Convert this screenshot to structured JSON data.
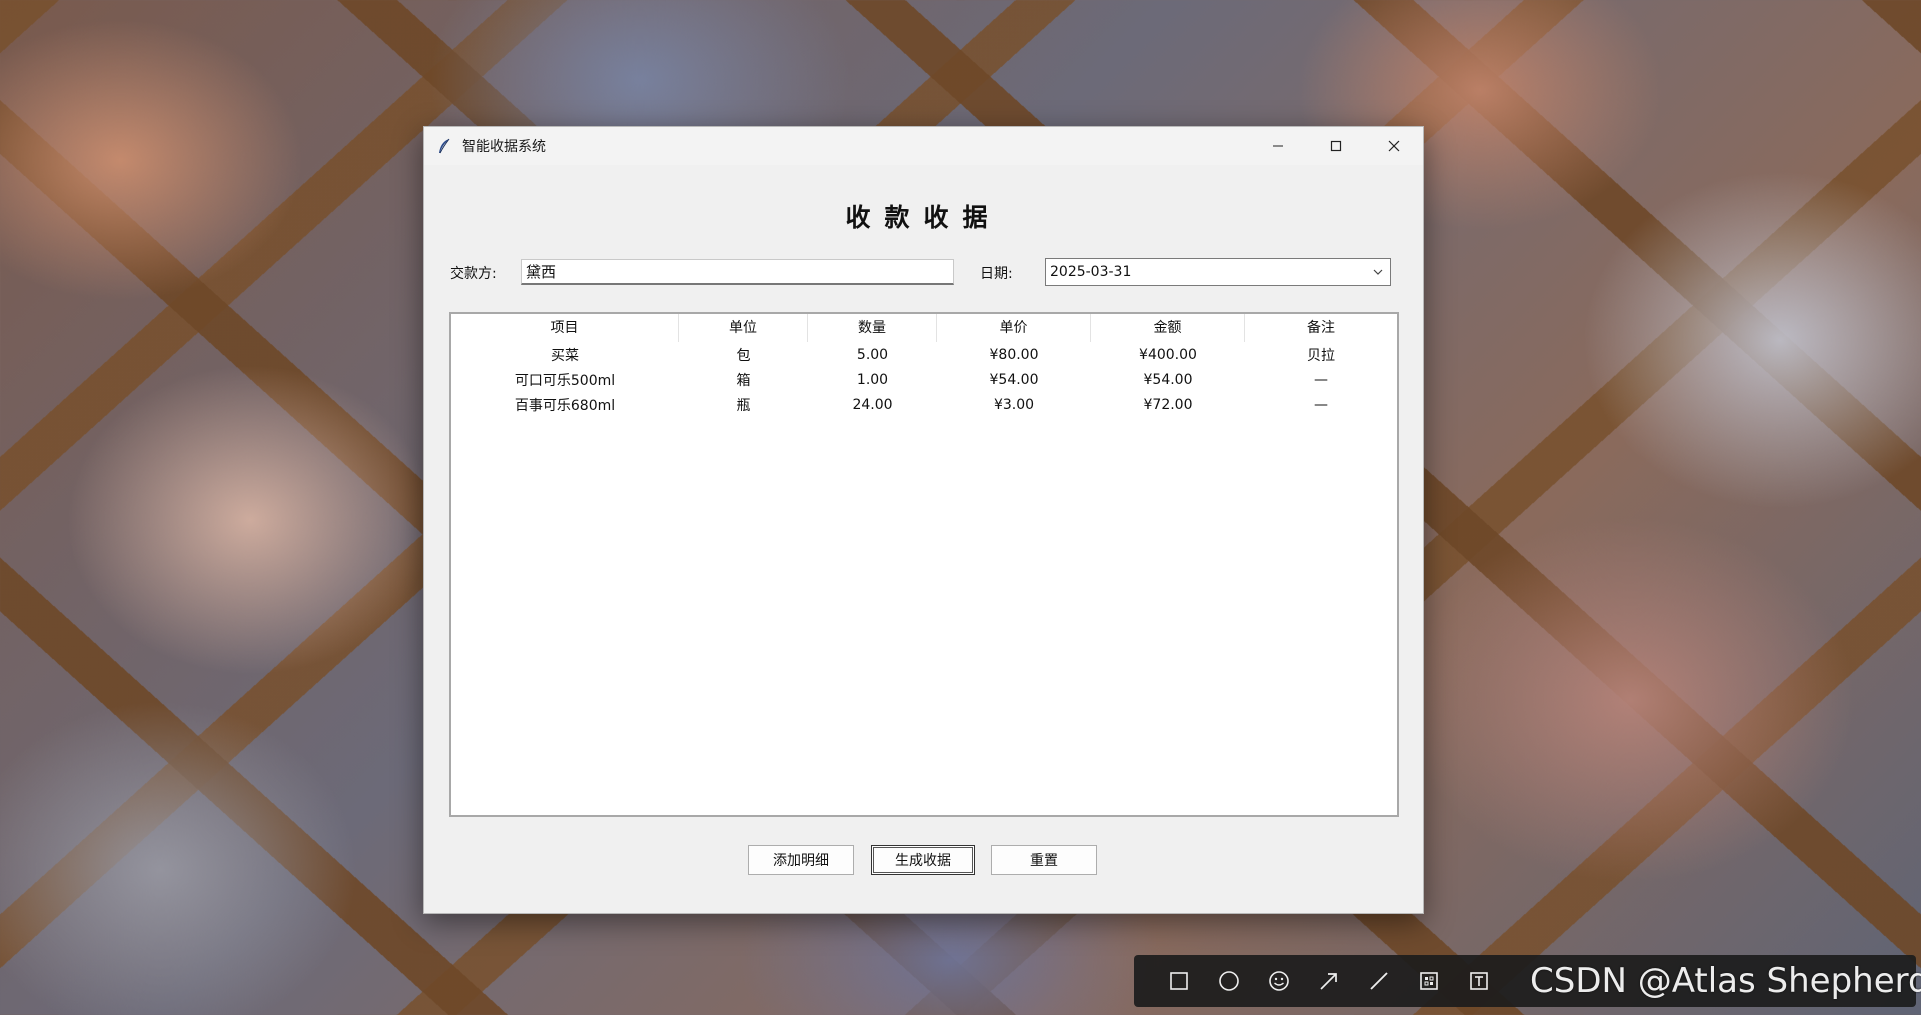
{
  "window": {
    "title": "智能收据系统",
    "controls": [
      "minimize",
      "maximize",
      "close"
    ]
  },
  "receipt": {
    "heading": "收款收据",
    "payer_label": "交款方:",
    "payer_value": "黛西",
    "date_label": "日期:",
    "date_value": "2025-03-31"
  },
  "table": {
    "columns": [
      "项目",
      "单位",
      "数量",
      "单价",
      "金额",
      "备注"
    ],
    "rows": [
      [
        "买菜",
        "包",
        "5.00",
        "¥80.00",
        "¥400.00",
        "贝拉"
      ],
      [
        "可口可乐500ml",
        "箱",
        "1.00",
        "¥54.00",
        "¥54.00",
        "—"
      ],
      [
        "百事可乐680ml",
        "瓶",
        "24.00",
        "¥3.00",
        "¥72.00",
        "—"
      ]
    ]
  },
  "buttons": {
    "add_detail": "添加明细",
    "generate": "生成收据",
    "reset": "重置"
  },
  "toolbar": {
    "icons": [
      "rectangle-icon",
      "ellipse-icon",
      "emoji-icon",
      "arrow-icon",
      "line-icon",
      "mosaic-icon",
      "text-icon"
    ]
  },
  "watermark": "CSDN @Atlas Shepherd"
}
